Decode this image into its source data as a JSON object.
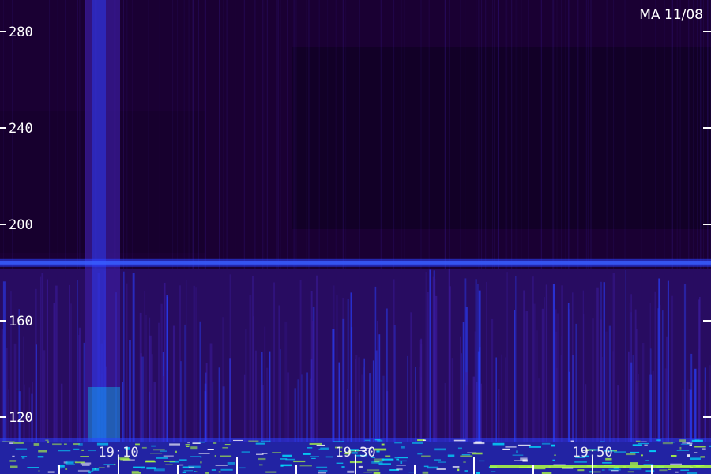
{
  "chart_data": {
    "type": "heatmap",
    "title": "MA 11/08",
    "y_ticks": [
      280,
      240,
      200,
      160,
      120
    ],
    "ylim": [
      110,
      290
    ],
    "x_ticks": [
      "19:10",
      "19:30",
      "19:50"
    ],
    "x_tick_times_min": [
      1150,
      1170,
      1190
    ],
    "xlim_min": [
      1140,
      1199
    ],
    "bright_band_y": 184,
    "bright_column_time_min": 1148,
    "colors": {
      "background": "#000000",
      "low": "#1a0033",
      "mid": "#3a1a9a",
      "high": "#2a40ff",
      "peak": "#00e0ff",
      "hot": "#b0ff40"
    }
  }
}
